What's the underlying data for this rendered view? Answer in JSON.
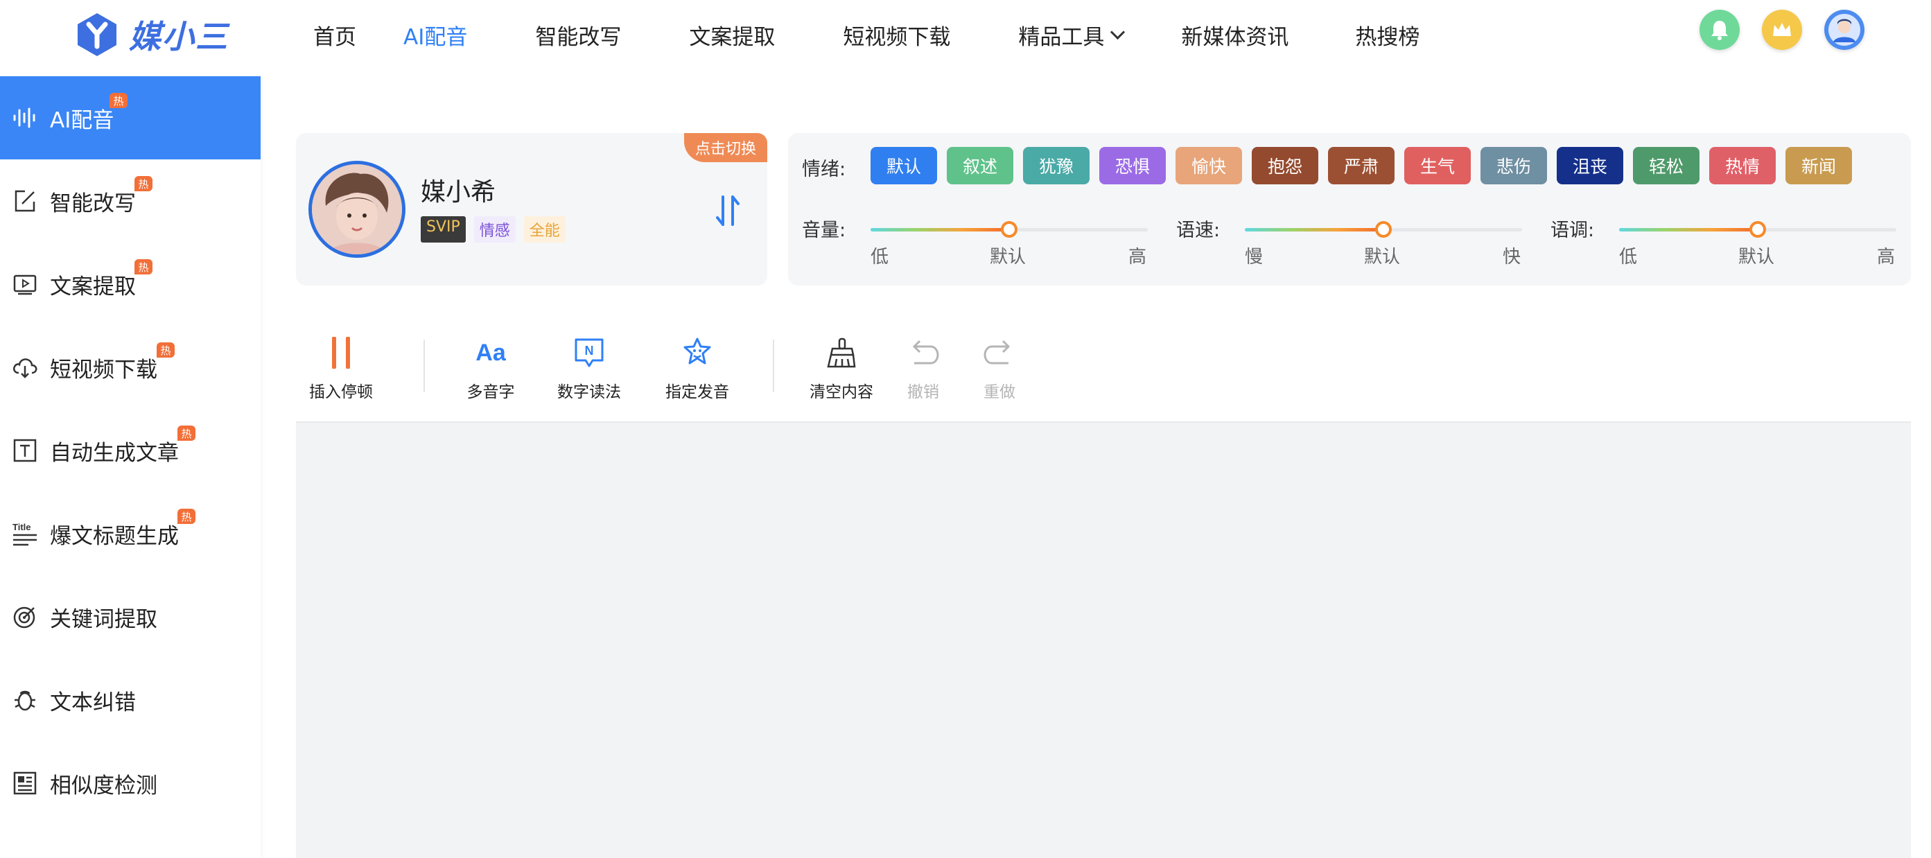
{
  "brand": {
    "name": "媒小三",
    "color": "#3d6fe0"
  },
  "nav": {
    "items": [
      {
        "label": "首页",
        "active": false
      },
      {
        "label": "AI配音",
        "active": true
      },
      {
        "label": "智能改写",
        "active": false
      },
      {
        "label": "文案提取",
        "active": false
      },
      {
        "label": "短视频下载",
        "active": false
      },
      {
        "label": "精品工具",
        "active": false,
        "dropdown": true
      },
      {
        "label": "新媒体资讯",
        "active": false
      },
      {
        "label": "热搜榜",
        "active": false
      }
    ],
    "right_icons": [
      "bell-icon",
      "crown-icon",
      "user-avatar-icon"
    ]
  },
  "sidebar": {
    "hot_badge": "热",
    "items": [
      {
        "label": "AI配音",
        "icon": "waveform-icon",
        "hot": true,
        "active": true
      },
      {
        "label": "智能改写",
        "icon": "edit-icon",
        "hot": true
      },
      {
        "label": "文案提取",
        "icon": "video-text-icon",
        "hot": true
      },
      {
        "label": "短视频下载",
        "icon": "cloud-download-icon",
        "hot": true
      },
      {
        "label": "自动生成文章",
        "icon": "text-box-icon",
        "hot": true
      },
      {
        "label": "爆文标题生成",
        "icon": "title-icon",
        "hot": true
      },
      {
        "label": "关键词提取",
        "icon": "target-icon",
        "hot": false
      },
      {
        "label": "文本纠错",
        "icon": "bug-icon",
        "hot": false
      },
      {
        "label": "相似度检测",
        "icon": "document-compare-icon",
        "hot": false
      }
    ]
  },
  "voice": {
    "switch_label": "点击切换",
    "name": "媒小希",
    "tags": [
      "SVIP",
      "情感",
      "全能"
    ]
  },
  "emotion": {
    "label": "情绪:",
    "chips": [
      {
        "label": "默认",
        "color": "#2f7ff0"
      },
      {
        "label": "叙述",
        "color": "#5fc28a"
      },
      {
        "label": "犹豫",
        "color": "#4aaaa6"
      },
      {
        "label": "恐惧",
        "color": "#9b6be6"
      },
      {
        "label": "愉快",
        "color": "#e8a57a"
      },
      {
        "label": "抱怨",
        "color": "#944a2e"
      },
      {
        "label": "严肃",
        "color": "#9c5033"
      },
      {
        "label": "生气",
        "color": "#e06060"
      },
      {
        "label": "悲伤",
        "color": "#6f8fa2"
      },
      {
        "label": "沮丧",
        "color": "#14308a"
      },
      {
        "label": "轻松",
        "color": "#4f9a6a"
      },
      {
        "label": "热情",
        "color": "#e06068"
      },
      {
        "label": "新闻",
        "color": "#c99b50"
      }
    ]
  },
  "sliders": [
    {
      "label": "音量:",
      "low": "低",
      "mid": "默认",
      "high": "高",
      "value": 0.5
    },
    {
      "label": "语速:",
      "low": "慢",
      "mid": "默认",
      "high": "快",
      "value": 0.5
    },
    {
      "label": "语调:",
      "low": "低",
      "mid": "默认",
      "high": "高",
      "value": 0.5
    }
  ],
  "toolbar": {
    "pause": "插入停顿",
    "polyphone": "多音字",
    "polyphone_glyph": "Aa",
    "number": "数字读法",
    "number_glyph": "N",
    "pronounce": "指定发音",
    "clear": "清空内容",
    "undo": "撤销",
    "redo": "重做"
  }
}
